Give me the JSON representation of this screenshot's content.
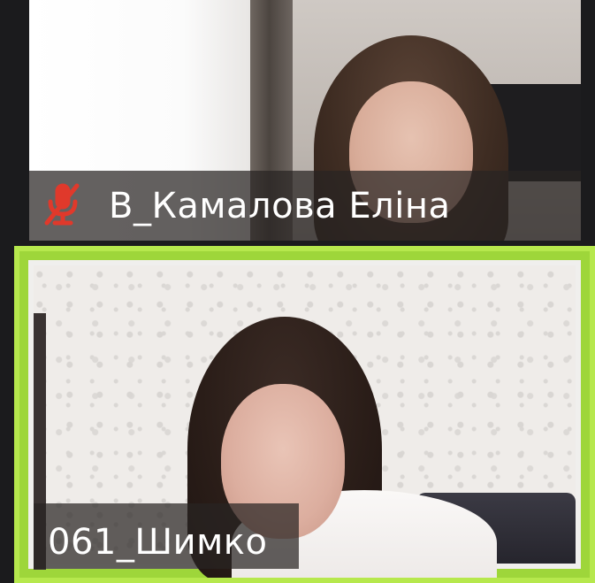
{
  "participants": [
    {
      "name": "В_Камалова Еліна",
      "muted": true,
      "mic_icon": "muted-mic-icon",
      "active_speaker": false
    },
    {
      "name": "061_Шимко",
      "muted": false,
      "active_speaker": true
    }
  ],
  "colors": {
    "active_speaker_border": "#b6e84d",
    "muted_icon": "#e0392b",
    "name_text": "#ffffff",
    "name_bar": "#282422"
  }
}
